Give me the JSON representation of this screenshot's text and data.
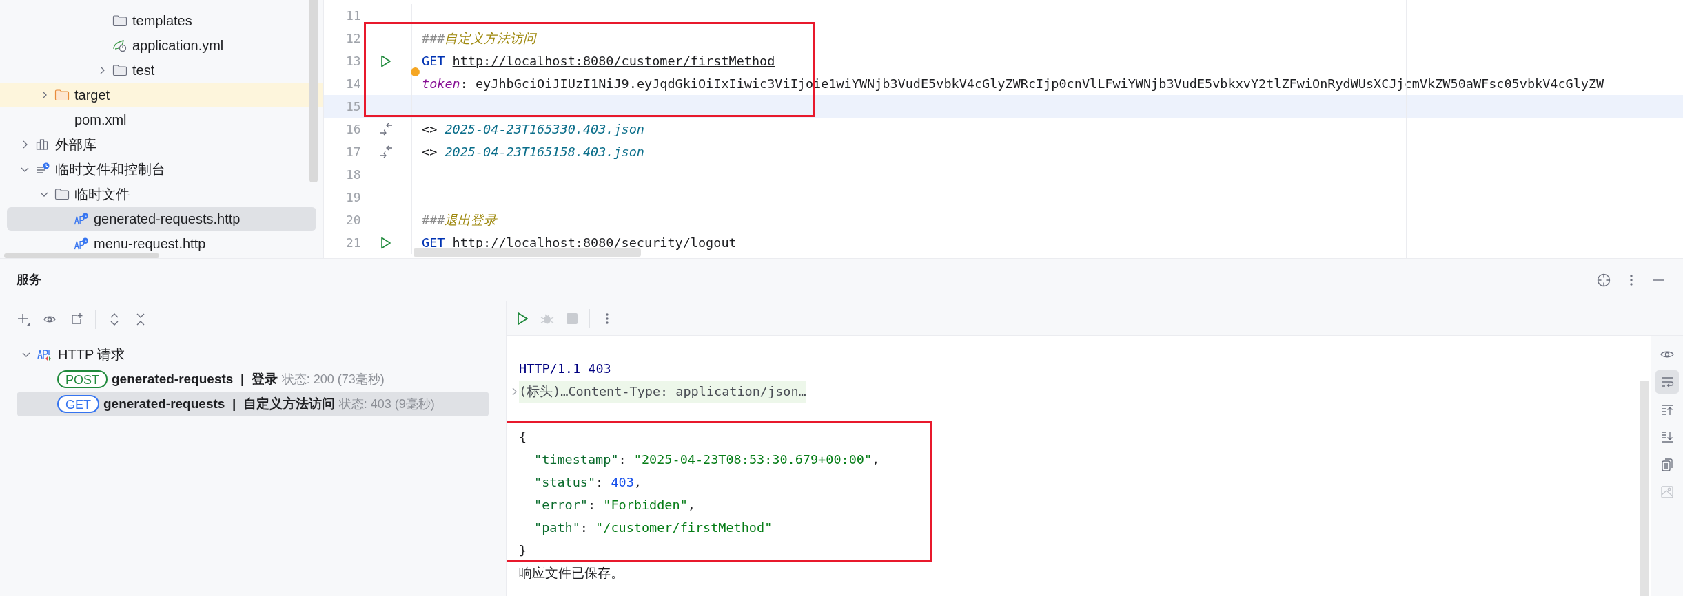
{
  "project_tree": {
    "items": [
      {
        "children": [
          {
            "children": [
              {
                "children": [
                  {
                    "children": [
                      {
                        "label": "templates",
                        "kind": "folder",
                        "selected": false
                      },
                      {
                        "label": "application.yml",
                        "kind": "yaml",
                        "selected": false
                      },
                      {
                        "label": "test",
                        "kind": "folder",
                        "expanded": false,
                        "selected": false
                      }
                    ]
                  }
                ]
              }
            ]
          },
          {
            "label": "target",
            "kind": "excluded-folder",
            "expanded": false,
            "selected": false
          },
          {
            "label": "pom.xml",
            "kind": "maven",
            "selected": false
          }
        ]
      },
      {
        "label": "外部库",
        "kind": "library",
        "expanded": false,
        "selected": false
      },
      {
        "label": "临时文件和控制台",
        "kind": "scratches",
        "expanded": true,
        "selected": false,
        "children": [
          {
            "label": "临时文件",
            "kind": "folder",
            "expanded": true,
            "selected": false,
            "children": [
              {
                "label": "generated-requests.http",
                "kind": "http",
                "selected": true
              },
              {
                "label": "menu-request.http",
                "kind": "http",
                "selected": false
              }
            ]
          }
        ]
      }
    ]
  },
  "editor": {
    "lines": [
      {
        "number": "11",
        "current": false,
        "kind": "blank",
        "bulb": false
      },
      {
        "number": "12",
        "current": false,
        "kind": "comment",
        "bulb": false,
        "mark": "###",
        "comment": "自定义方法访问"
      },
      {
        "number": "13",
        "current": false,
        "kind": "request",
        "bulb": false,
        "method": "GET",
        "url": "http://localhost:8080/customer/firstMethod"
      },
      {
        "number": "14",
        "current": false,
        "kind": "header",
        "bulb": true,
        "name": "token",
        "value": ": eyJhbGciOiJIUzI1NiJ9.eyJqdGkiOiIxIiwic3ViIjoie1wiYWNjb3VudE5vbkV4cGlyZWRcIjp0cnVlLFwiYWNjb3VudE5vbkxvY2tlZFwiOnRydWUsXCJjcmVkZW50aWFsc05vbkV4cGlyZW"
      },
      {
        "number": "15",
        "current": true,
        "kind": "blank",
        "bulb": false
      },
      {
        "number": "16",
        "current": false,
        "kind": "response-file",
        "bulb": false,
        "prefix": "<> ",
        "file": "2025-04-23T165330.403.json"
      },
      {
        "number": "17",
        "current": false,
        "kind": "response-file",
        "bulb": false,
        "prefix": "<> ",
        "file": "2025-04-23T165158.403.json"
      },
      {
        "number": "18",
        "current": false,
        "kind": "blank",
        "bulb": false
      },
      {
        "number": "19",
        "current": false,
        "kind": "blank",
        "bulb": false
      },
      {
        "number": "20",
        "current": false,
        "kind": "comment",
        "bulb": false,
        "mark": "###",
        "comment": "退出登录"
      },
      {
        "number": "21",
        "current": false,
        "kind": "request",
        "bulb": false,
        "method": "GET",
        "url": "http://localhost:8080/security/logout"
      }
    ]
  },
  "services": {
    "title": "服务",
    "tree": {
      "label": "HTTP 请求",
      "expanded": true,
      "requests": [
        {
          "method": "POST",
          "color": "#208a3c",
          "name": "generated-requests  |  登录",
          "status": "状态: 200 (73毫秒)",
          "selected": false
        },
        {
          "method": "GET",
          "color": "#3574f0",
          "name": "generated-requests  |  自定义方法访问",
          "status": "状态: 403 (9毫秒)",
          "selected": true
        }
      ]
    },
    "run_toolbar": [
      {
        "disabled": false
      },
      {
        "disabled": true
      },
      {
        "disabled": true
      }
    ],
    "output": {
      "lines": [
        {
          "kind": "status",
          "text": "HTTP/1.1 403"
        },
        {
          "kind": "fold",
          "text": "(标头)…Content-Type: application/json…"
        },
        {
          "kind": "blank"
        },
        {
          "kind": "brace",
          "text": "{"
        },
        {
          "kind": "string-field",
          "key": "\"timestamp\"",
          "sep": ": ",
          "value": "\"2025-04-23T08:53:30.679+00:00\"",
          "end": ","
        },
        {
          "kind": "number-field",
          "key": "\"status\"",
          "sep": ": ",
          "value": "403",
          "end": ","
        },
        {
          "kind": "string-field",
          "key": "\"error\"",
          "sep": ": ",
          "value": "\"Forbidden\"",
          "end": ","
        },
        {
          "kind": "string-field",
          "key": "\"path\"",
          "sep": ": ",
          "value": "\"/customer/firstMethod\""
        },
        {
          "kind": "brace",
          "text": "}"
        },
        {
          "kind": "note",
          "text": "响应文件已保存。"
        }
      ]
    },
    "side_toolbar": [
      {
        "selected": false,
        "disabled": false
      },
      {
        "selected": true,
        "disabled": false
      },
      {
        "selected": false,
        "disabled": false
      },
      {
        "selected": false,
        "disabled": false
      },
      {
        "selected": false,
        "disabled": false
      },
      {
        "selected": false,
        "disabled": true
      }
    ]
  }
}
